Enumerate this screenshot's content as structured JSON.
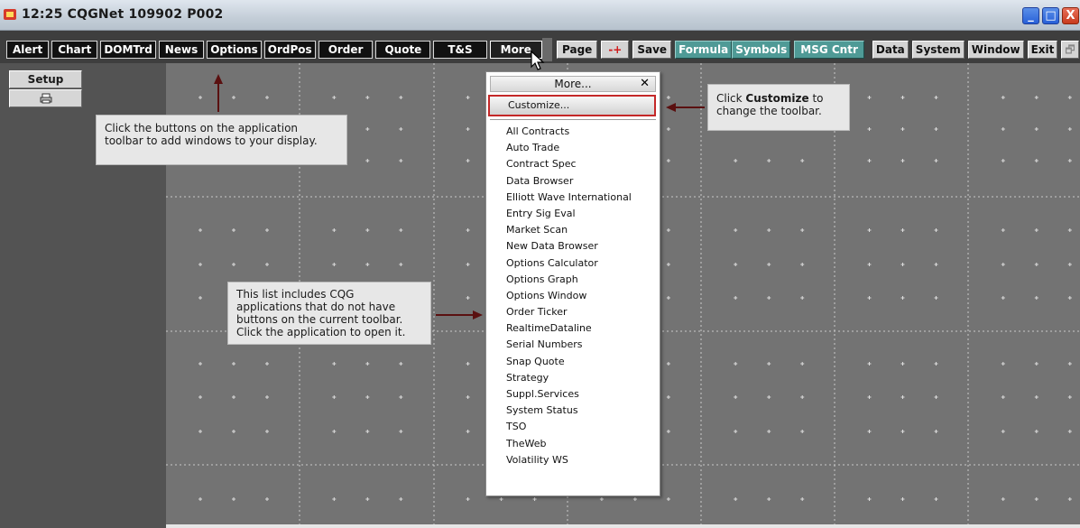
{
  "window": {
    "title": "12:25  CQGNet 109902   P002",
    "minimize": "_",
    "maximize": "□",
    "close": "X"
  },
  "toolbar": {
    "left_buttons": [
      "Alert",
      "Chart",
      "DOMTrd",
      "News",
      "Options",
      "OrdPos",
      "Order",
      "Quote",
      "T&S",
      "More"
    ],
    "page": "Page",
    "minus_plus": "-+",
    "save": "Save",
    "formula": "Formula",
    "symbols": "Symbols",
    "msg_cntr": "MSG Cntr",
    "data": "Data",
    "system": "System",
    "window": "Window",
    "exit": "Exit",
    "restore_icon": "🗗",
    "help": "?"
  },
  "sidebar": {
    "setup": "Setup",
    "print_icon": "printer-icon"
  },
  "callouts": {
    "toolbar_hint": "Click the buttons on the application toolbar to add windows to your display.",
    "customize_hint_pre": "Click ",
    "customize_hint_bold": "Customize",
    "customize_hint_post": " to change the toolbar.",
    "list_hint": "This list includes CQG applications that do not have buttons on the current toolbar. Click the application to open it."
  },
  "menu": {
    "header": "More...",
    "close": "✕",
    "customize": "Customize...",
    "items": [
      "All Contracts",
      "Auto Trade",
      "Contract Spec",
      "Data Browser",
      "Elliott Wave International",
      "Entry Sig Eval",
      "Market Scan",
      "New Data Browser",
      "Options Calculator",
      "Options Graph",
      "Options Window",
      "Order Ticker",
      "RealtimeDataline",
      "Serial Numbers",
      "Snap Quote",
      "Strategy",
      "Suppl.Services",
      "System Status",
      "TSO",
      "TheWeb",
      "Volatility WS"
    ]
  },
  "colors": {
    "toolbar_bg": "#3e3e3e",
    "sidebar_bg": "#535353",
    "desktop_bg": "#737373",
    "highlight": "#c42828",
    "teal_button": "#4f9a96"
  }
}
